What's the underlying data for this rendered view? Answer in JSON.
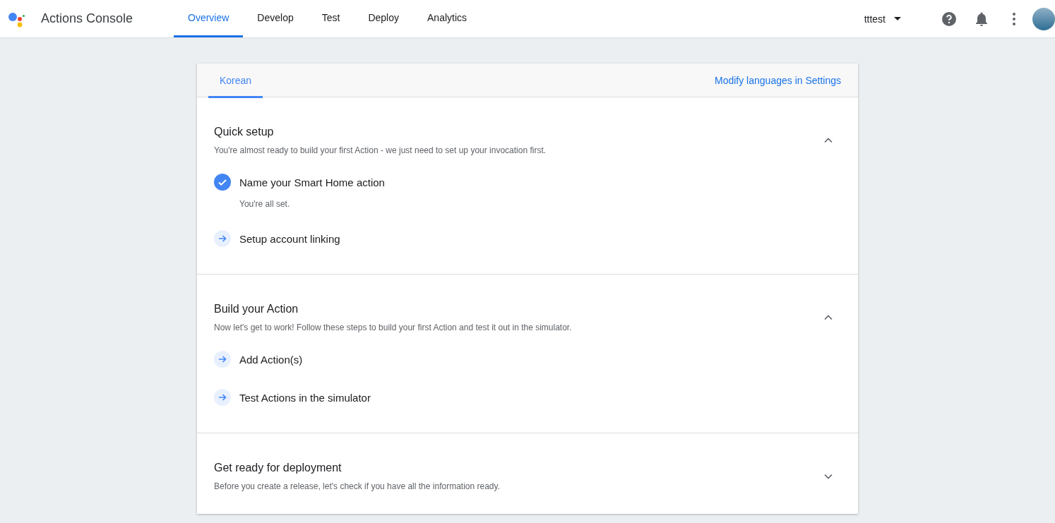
{
  "app": {
    "title": "Actions Console"
  },
  "nav": [
    {
      "label": "Overview",
      "selected": true
    },
    {
      "label": "Develop",
      "selected": false
    },
    {
      "label": "Test",
      "selected": false
    },
    {
      "label": "Deploy",
      "selected": false
    },
    {
      "label": "Analytics",
      "selected": false
    }
  ],
  "project": {
    "name": "tttest"
  },
  "language_tabs": [
    {
      "label": "Korean",
      "selected": true
    }
  ],
  "settings_link": "Modify languages in Settings",
  "sections": [
    {
      "title": "Quick setup",
      "description": "You're almost ready to build your first Action - we just need to set up your invocation first.",
      "expanded": true,
      "steps": [
        {
          "kind": "done",
          "label": "Name your Smart Home action",
          "note": "You're all set."
        },
        {
          "kind": "todo",
          "label": "Setup account linking"
        }
      ]
    },
    {
      "title": "Build your Action",
      "description": "Now let's get to work! Follow these steps to build your first Action and test it out in the simulator.",
      "expanded": true,
      "steps": [
        {
          "kind": "todo",
          "label": "Add Action(s)"
        },
        {
          "kind": "todo",
          "label": "Test Actions in the simulator"
        }
      ]
    },
    {
      "title": "Get ready for deployment",
      "description": "Before you create a release, let's check if you have all the information ready.",
      "expanded": false
    }
  ]
}
